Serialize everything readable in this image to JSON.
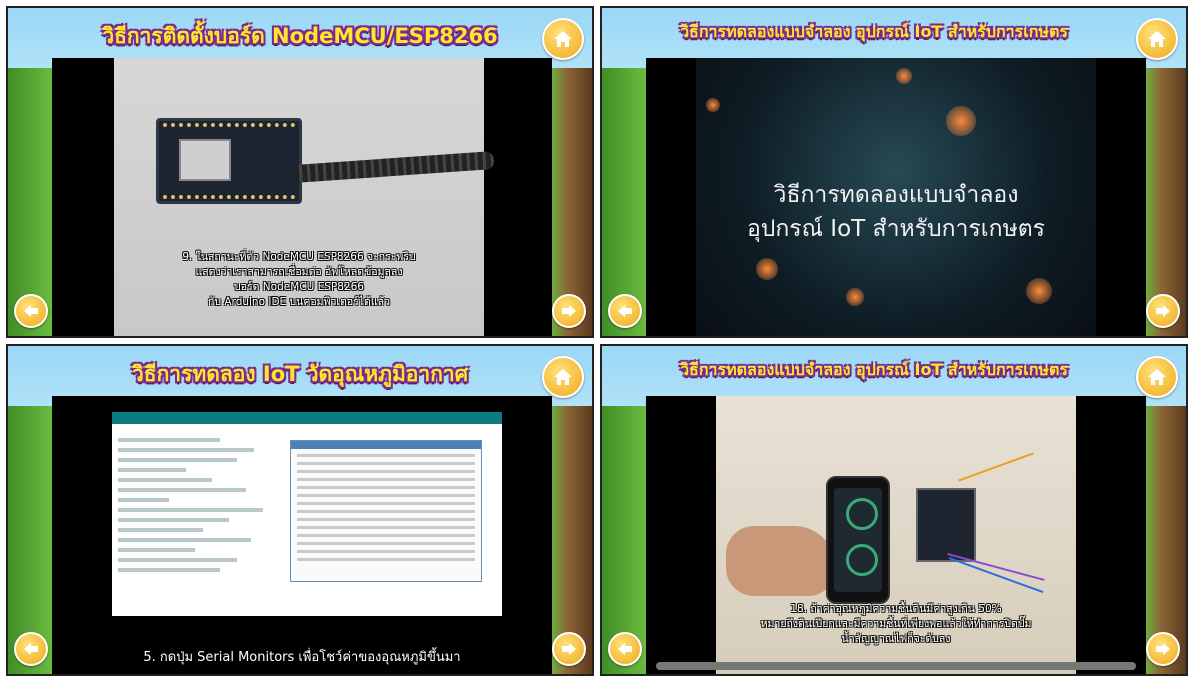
{
  "panels": [
    {
      "title": "วิธีการติดตั้งบอร์ด NodeMCU/ESP8266",
      "caption_lines": [
        "9. ในสถานะที่ตัว NodeMCU ESP8266 จะกระพริบ",
        "แสดงว่าเราสามารถเชื่อมต่อ อัพโหลดข้อมูลลง",
        "บอร์ด NodeMCU ESP8266",
        "กับ Arduino IDE บนคอมพิวเตอร์ได้แล้ว"
      ]
    },
    {
      "title": "วิธีการทดลองแบบจำลอง อุปกรณ์ IoT สำหรับการเกษตร",
      "video_title_lines": [
        "วิธีการทดลองแบบจำลอง",
        "อุปกรณ์ IoT สำหรับการเกษตร"
      ]
    },
    {
      "title": "วิธีการทดลอง IoT วัดอุณหภูมิอากาศ",
      "caption": "5. กดปุ่ม Serial Monitors เพื่อโชว์ค่าของอุณหภูมิขึ้นมา"
    },
    {
      "title": "วิธีการทดลองแบบจำลอง อุปกรณ์ IoT สำหรับการเกษตร",
      "caption_lines": [
        "18. ถ้าค่าอุณหภูมิความชื้นดินมีค่าสูงเกิน 50%",
        "หมายถึงดินเปียกและมีความชื้นที่เพียงพอแล้วให้ทำการปิดปั๊ม",
        "น้ำสัญญาณไฟก็จะดับลง"
      ]
    }
  ],
  "icons": {
    "home": "home-icon",
    "prev": "arrow-left-icon",
    "next": "arrow-right-icon"
  },
  "colors": {
    "banner_text": "#ffe62e",
    "banner_outline": "#7a2a8c",
    "button": "#f0a81c"
  }
}
